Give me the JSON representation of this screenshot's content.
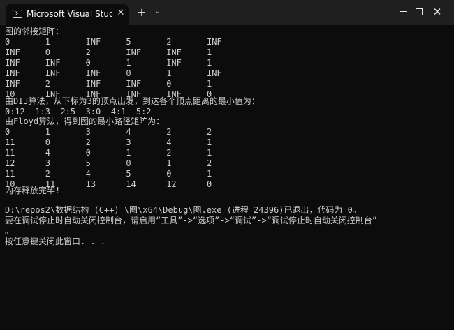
{
  "window": {
    "tab_title": "Microsoft Visual Studio 调试控制台",
    "tab_close": "✕",
    "new_tab": "+",
    "tab_dropdown": "⌄",
    "minimize": "",
    "maximize": "",
    "close": "✕"
  },
  "console": {
    "lines": [
      "图的邻接矩阵：",
      "0       1       INF     5       2       INF",
      "INF     0       2       INF     INF     1",
      "INF     INF     0       1       INF     1",
      "INF     INF     INF     0       1       INF",
      "INF     2       INF     INF     0       1",
      "10      INF     INF     INF     INF     0",
      "由DIJ算法，从下标为3的顶点出发，到达各个顶点距离的最小值为：",
      "0:12  1:3  2:5  3:0  4:1  5:2",
      "由Floyd算法，得到图的最小路径矩阵为：",
      "0       1       3       4       2       2",
      "11      0       2       3       4       1",
      "11      4       0       1       2       1",
      "12      3       5       0       1       2",
      "11      2       4       5       0       1",
      "10      11      13      14      12      0",
      "内存释放完毕!",
      "",
      "D:\\repos2\\数据结构 (C++) \\图\\x64\\Debug\\图.exe (进程 24396)已退出，代码为 0。",
      "要在调试停止时自动关闭控制台，请启用“工具”->“选项”->“调试”->“调试停止时自动关闭控制台”",
      "。",
      "按任意键关闭此窗口. . ."
    ]
  }
}
